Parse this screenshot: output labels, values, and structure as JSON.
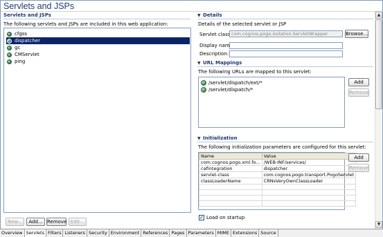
{
  "page": {
    "title": "Servlets and JSPs"
  },
  "left": {
    "heading": "Servlets and JSPs",
    "description": "The following servlets and JSPs are included in this web application:",
    "items": [
      {
        "label": "cfgss",
        "selected": false
      },
      {
        "label": "dispatcher",
        "selected": true
      },
      {
        "label": "gc",
        "selected": false
      },
      {
        "label": "CMServlet",
        "selected": false
      },
      {
        "label": "ping",
        "selected": false
      }
    ],
    "buttons": {
      "new": "New...",
      "add": "Add...",
      "remove": "Remove",
      "edit": "Edit..."
    }
  },
  "details": {
    "heading": "Details",
    "description": "Details of the selected servlet or JSP",
    "servlet_class_label": "Servlet class:",
    "servlet_class_value": "com.cognos.pogo.isolation.ServletWrapper",
    "browse_button": "Browse...",
    "display_name_label": "Display name:",
    "display_name_value": "",
    "description_label": "Description:",
    "description_value": ""
  },
  "url_mappings": {
    "heading": "URL Mappings",
    "description": "The following URLs are mapped to this servlet:",
    "items": [
      "/servlet/dispatch/ext/*",
      "/servlet/dispatch/*"
    ],
    "add_button": "Add",
    "remove_button": "Remove"
  },
  "initialization": {
    "heading": "Initialization",
    "description": "The following initialization parameters are configured for this servlet:",
    "columns": [
      "Name",
      "Value"
    ],
    "rows": [
      [
        "com.cognos.pogo.xml.fo...",
        "/WEB-INF/services/"
      ],
      [
        "cafintegration",
        "dispatcher"
      ],
      [
        "servlet-class",
        "com.cognos.pogo.transport.PogoServlet"
      ],
      [
        "classLoaderName",
        "CRNsVeryOwnClassLoader"
      ]
    ],
    "empty_rows": 4,
    "add_button": "Add",
    "remove_button": "Remove",
    "load_on_startup_label": "Load on startup",
    "load_on_startup_checked": true
  },
  "tabs": [
    "Overview",
    "Servlets",
    "Filters",
    "Listeners",
    "Security",
    "Environment",
    "References",
    "Pages",
    "Parameters",
    "MIME",
    "Extensions",
    "Source"
  ],
  "active_tab": "Servlets",
  "icons": {
    "servlet_item": "servlet-globe-icon",
    "url_item": "url-mapping-icon",
    "collapse": "section-collapse-icon"
  }
}
